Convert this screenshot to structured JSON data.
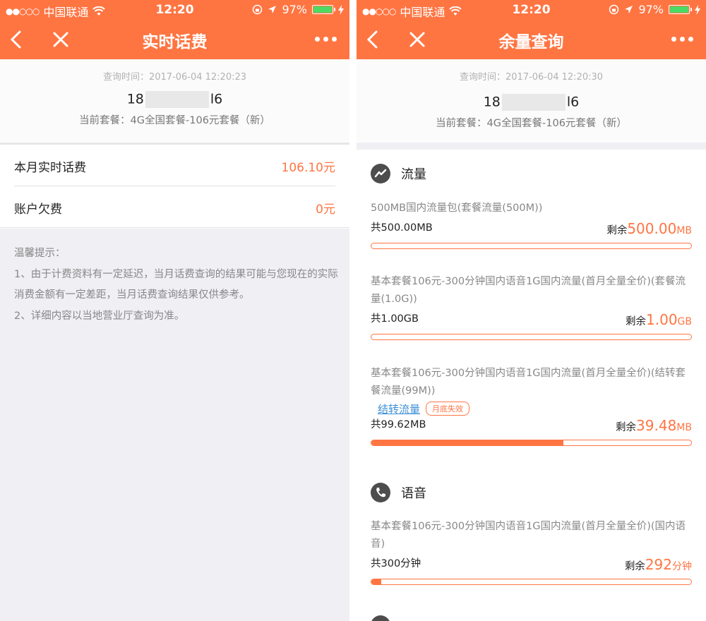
{
  "status": {
    "signal": "●●○○○",
    "carrier": "中国联通",
    "time": "12:20",
    "battery": "97%"
  },
  "left": {
    "nav_title": "实时话费",
    "query_time": "查询时间：2017-06-04 12:20:23",
    "phone_prefix": "18",
    "phone_suffix": "l6",
    "plan": "当前套餐：4G全国套餐-106元套餐（新）",
    "rows": [
      {
        "label": "本月实时话费",
        "value": "106.10元"
      },
      {
        "label": "账户欠费",
        "value": "0元"
      }
    ],
    "tips": {
      "title": "温馨提示：",
      "line1": "1、由于计费资料有一定延迟，当月话费查询的结果可能与您现在的实际消费金额有一定差距，当月话费查询结果仅供参考。",
      "line2": "2、详细内容以当地营业厅查询为准。"
    }
  },
  "right": {
    "nav_title": "余量查询",
    "query_time": "查询时间：2017-06-04 12:20:30",
    "phone_prefix": "18",
    "phone_suffix": "l6",
    "plan": "当前套餐：4G全国套餐-106元套餐（新）",
    "remain_label": "剩余",
    "data_section": {
      "title": "流量",
      "items": [
        {
          "name": "500MB国内流量包(套餐流量(500M))",
          "total": "共500.00MB",
          "remain": "500.00",
          "unit": "MB",
          "used_fraction": 0.0
        },
        {
          "name": "基本套餐106元-300分钟国内语音1G国内流量(首月全量全价)(套餐流量(1.0G))",
          "total": "共1.00GB",
          "remain": "1.00",
          "unit": "GB",
          "used_fraction": 0.0
        },
        {
          "name": "基本套餐106元-300分钟国内语音1G国内流量(首月全量全价)(结转套餐流量(99M))",
          "link": "结转流量",
          "badge": "月底失效",
          "total": "共99.62MB",
          "remain": "39.48",
          "unit": "MB",
          "used_fraction": 0.6
        }
      ]
    },
    "voice_section": {
      "title": "语音",
      "items": [
        {
          "name": "基本套餐106元-300分钟国内语音1G国内流量(首月全量全价)(国内语音)",
          "total": "共300分钟",
          "remain": "292",
          "unit": "分钟",
          "used_fraction": 0.03
        }
      ]
    }
  }
}
